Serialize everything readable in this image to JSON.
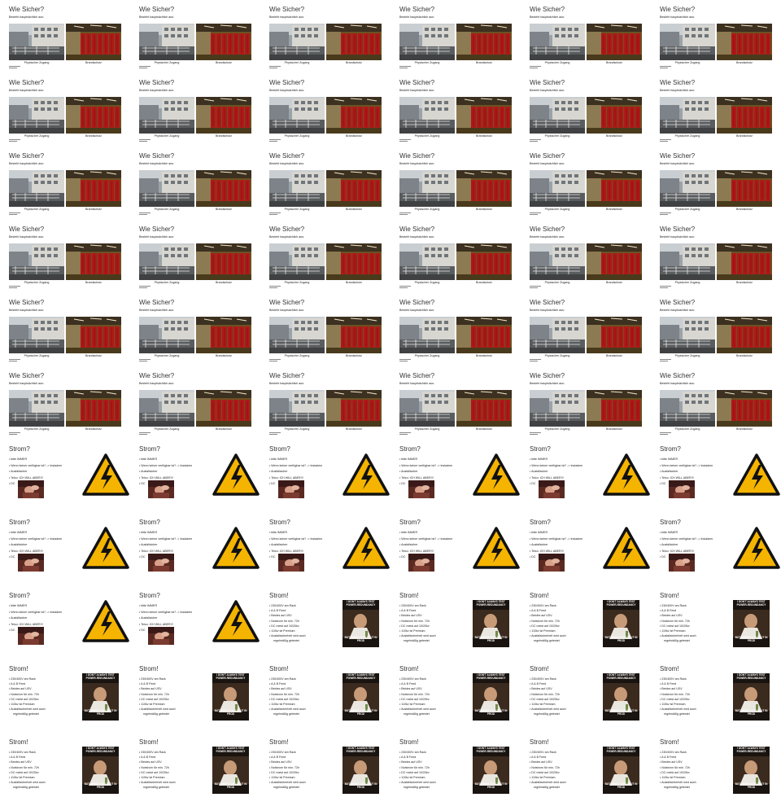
{
  "deck": {
    "type_a": {
      "title": "Wie Sicher?",
      "subtitle": "Besteht hauptsächlich aus:",
      "caption_left": "Physischer Zugang",
      "caption_right": "Brandschutz"
    },
    "type_b": {
      "title": "Strom?",
      "bullets": [
        "bitte IMMER",
        "Wenn keiner verfügbar ist? -> Instadem",
        "Ausfallsicher",
        "Telco: ICH WILL ABER!!!",
        "DC"
      ]
    },
    "type_c": {
      "title": "Strom!",
      "bullets": [
        "230/400V am Rack",
        "A & B Feed",
        "Beides auf USV",
        "Notstrom für min. 72h",
        "DC meist auf 10/20kv",
        "110kv ist Premium",
        "Ausfallsicherheit wird auch",
        "regelmäßig getestet"
      ],
      "meme_top": "I DON'T ALWAYS TEST POWER-REDUNDANCY",
      "meme_bottom": "BUT WHEN I DO I DO IT IN PROD"
    },
    "layout": [
      [
        "A",
        "A",
        "A",
        "A",
        "A",
        "A"
      ],
      [
        "A",
        "A",
        "A",
        "A",
        "A",
        "A"
      ],
      [
        "A",
        "A",
        "A",
        "A",
        "A",
        "A"
      ],
      [
        "A",
        "A",
        "A",
        "A",
        "A",
        "A"
      ],
      [
        "A",
        "A",
        "A",
        "A",
        "A",
        "A"
      ],
      [
        "A",
        "A",
        "A",
        "A",
        "A",
        "A"
      ],
      [
        "B",
        "B",
        "B",
        "B",
        "B",
        "B"
      ],
      [
        "B",
        "B",
        "B",
        "B",
        "B",
        "B"
      ],
      [
        "B",
        "B",
        "C",
        "C",
        "C",
        "C"
      ],
      [
        "C",
        "C",
        "C",
        "C",
        "C",
        "C"
      ],
      [
        "C",
        "C",
        "C",
        "C",
        "C",
        "C"
      ]
    ]
  },
  "colors": {
    "background": "#c0c0c0",
    "slide": "#ffffff",
    "warning_yellow": "#f5b400",
    "rack_red": "#b01818"
  }
}
